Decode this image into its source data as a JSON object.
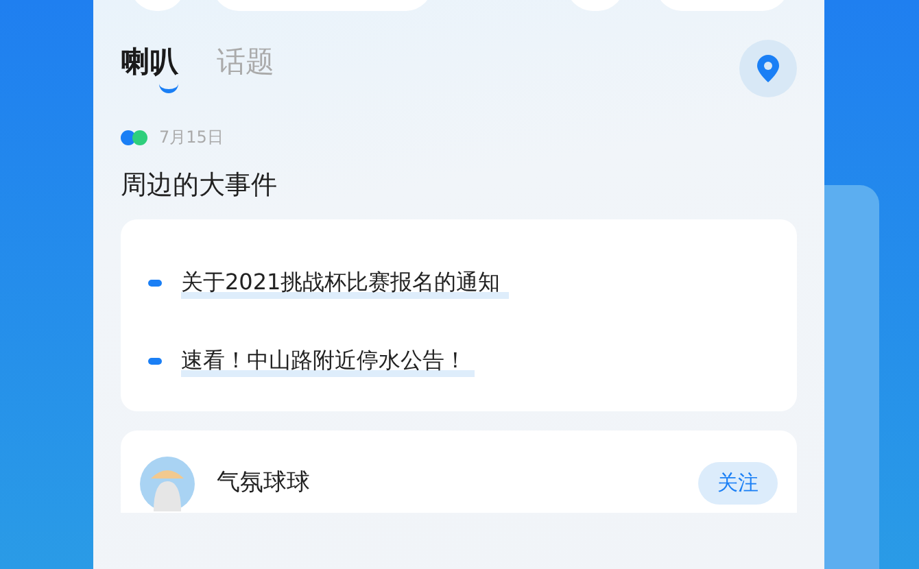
{
  "tabs": [
    {
      "label": "喇叭",
      "selected": true
    },
    {
      "label": "话题",
      "selected": false
    }
  ],
  "feed": {
    "date": "7月15日",
    "heading": "周边的大事件",
    "news": [
      "关于2021挑战杯比赛报名的通知",
      "速看！中山路附近停水公告！"
    ]
  },
  "post": {
    "author": "气氛球球",
    "follow_label": "关注"
  }
}
